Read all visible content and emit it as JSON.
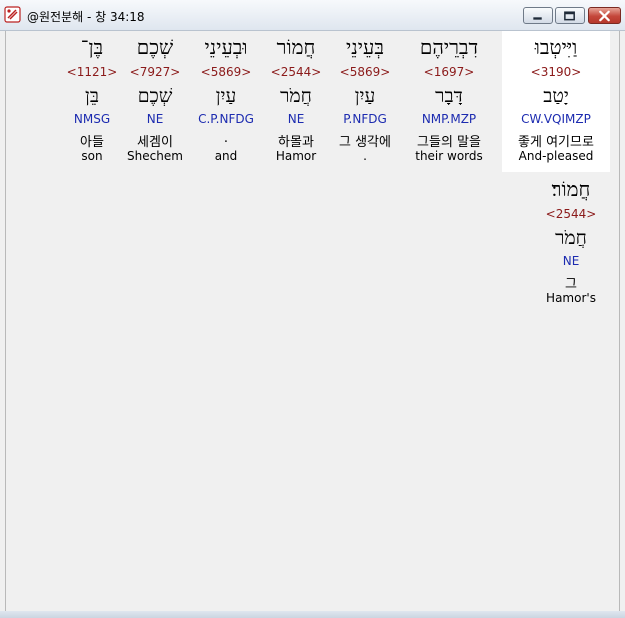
{
  "window": {
    "title": "@원전분해 - 창 34:18",
    "icon": "app-icon",
    "controls": [
      "minimize-icon",
      "maximize-icon",
      "close-icon"
    ]
  },
  "colors": {
    "strongs": "#8b1a1a",
    "parsing": "#1c2bb0",
    "selected_bg": "#ffffff"
  },
  "words": [
    {
      "hebrew": "וַיִּיטְבוּ",
      "strongs": "<3190>",
      "lemma": "יָטַב",
      "parsing": "CW.VQIMZP",
      "korean": "좋게 여기므로",
      "english": "And-pleased",
      "selected": true
    },
    {
      "hebrew": "דִבְרֵיהֶם",
      "strongs": "<1697>",
      "lemma": "דָּבָר",
      "parsing": "NMP.MZP",
      "korean": "그들의 말을",
      "english": "their words",
      "selected": false
    },
    {
      "hebrew": "בְּעֵינֵי",
      "strongs": "<5869>",
      "lemma": "עַיִן",
      "parsing": "P.NFDG",
      "korean": "그 생각에",
      "english": ".",
      "selected": false
    },
    {
      "hebrew": "חֲמוֹר",
      "strongs": "<2544>",
      "lemma": "חֲמֹר",
      "parsing": "NE",
      "korean": "하몰과",
      "english": "Hamor",
      "selected": false
    },
    {
      "hebrew": "וּבְעֵינֵי",
      "strongs": "<5869>",
      "lemma": "עַיִן",
      "parsing": "C.P.NFDG",
      "korean": ".",
      "english": "and",
      "selected": false
    },
    {
      "hebrew": "שְׁכֶם",
      "strongs": "<7927>",
      "lemma": "שְׁכֶם",
      "parsing": "NE",
      "korean": "세겜이",
      "english": "Shechem",
      "selected": false
    },
    {
      "hebrew": "בֶּן־",
      "strongs": "<1121>",
      "lemma": "בֵּן",
      "parsing": "NMSG",
      "korean": "아들",
      "english": "son",
      "selected": false
    },
    {
      "hebrew": "חֲמוֹר׃",
      "strongs": "<2544>",
      "lemma": "חֲמֹר",
      "parsing": "NE",
      "korean": "그",
      "english": "Hamor's",
      "selected": false
    }
  ]
}
